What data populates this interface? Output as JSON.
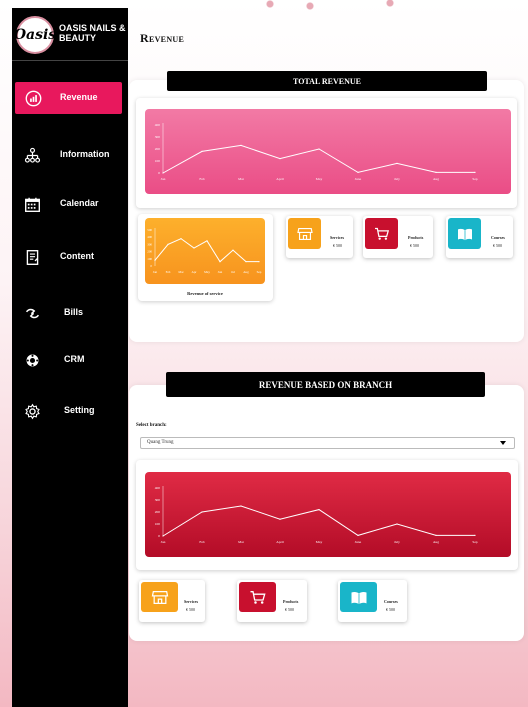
{
  "brand": {
    "logo_text": "Oasis",
    "name": "OASIS NAILS & BEAUTY"
  },
  "nav": [
    {
      "label": "Revenue",
      "icon": "chart-icon",
      "active": true
    },
    {
      "label": "Information",
      "icon": "hierarchy-icon"
    },
    {
      "label": "Calendar",
      "icon": "calendar-icon"
    },
    {
      "label": "Content",
      "icon": "document-icon"
    },
    {
      "label": "Bills",
      "icon": "bills-icon"
    },
    {
      "label": "CRM",
      "icon": "crm-icon"
    },
    {
      "label": "Setting",
      "icon": "gear-icon"
    }
  ],
  "page": {
    "title": "Revenue"
  },
  "total": {
    "banner": "TOTAL REVENUE",
    "mini_chart_caption": "Revenue of service"
  },
  "branch": {
    "banner": "REVENUE BASED ON BRANCH",
    "select_label": "Select branch:",
    "select_value": "Quang Trung"
  },
  "stats": [
    {
      "title": "Services",
      "value": "€ 500",
      "icon": "store-icon",
      "color": "#f7a21b"
    },
    {
      "title": "Products",
      "value": "€ 500",
      "icon": "cart-icon",
      "color": "#c8102e"
    },
    {
      "title": "Courses",
      "value": "€ 500",
      "icon": "book-icon",
      "color": "#19b5c9"
    }
  ],
  "colors": {
    "accent": "#e8185d",
    "pink_chart": "#ef5a8e",
    "orange_chart": "#fba31a",
    "red_chart": "#c5122f"
  },
  "chart_data": [
    {
      "type": "line",
      "x": [
        "Jan",
        "Feb",
        "Mar",
        "April",
        "May",
        "June",
        "July",
        "Aug",
        "Sep"
      ],
      "values": [
        0,
        180,
        230,
        120,
        200,
        5,
        80,
        5,
        5
      ],
      "yticks": [
        0,
        100,
        200,
        300,
        400
      ],
      "ylim": [
        0,
        400
      ]
    },
    {
      "type": "line",
      "x": [
        "Jan",
        "Feb",
        "Mar",
        "Apr",
        "May",
        "Jun",
        "Jul",
        "Aug",
        "Sep"
      ],
      "values": [
        80,
        300,
        380,
        250,
        350,
        60,
        220,
        60,
        60
      ],
      "yticks": [
        0,
        100,
        200,
        300,
        400,
        500
      ],
      "ylim": [
        0,
        500
      ]
    },
    {
      "type": "line",
      "x": [
        "Jan",
        "Feb",
        "Mar",
        "April",
        "May",
        "June",
        "July",
        "Aug",
        "Sep"
      ],
      "values": [
        0,
        200,
        250,
        140,
        220,
        5,
        100,
        5,
        5
      ],
      "yticks": [
        0,
        100,
        200,
        300,
        400
      ],
      "ylim": [
        0,
        400
      ]
    }
  ]
}
